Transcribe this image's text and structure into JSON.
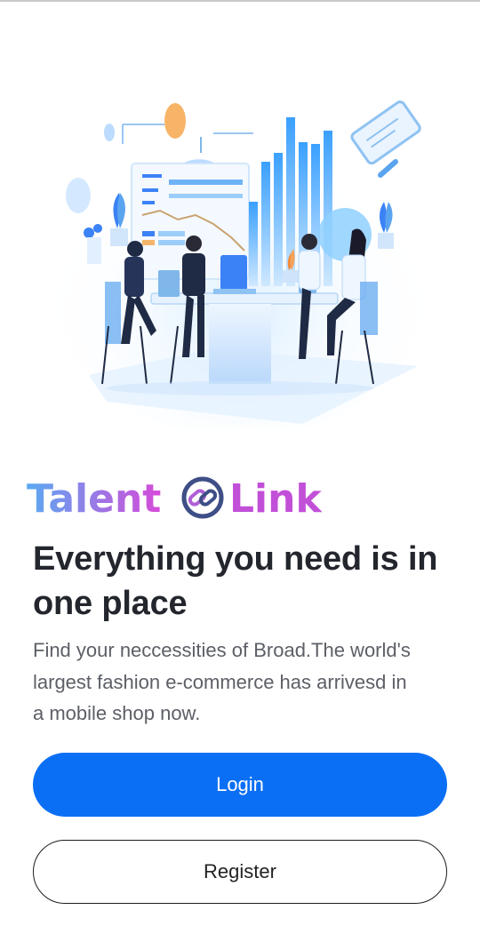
{
  "brand": {
    "part1": "Talent",
    "part2": "Link",
    "grad_start": "#5aaaf2",
    "grad_end": "#d64ad9"
  },
  "hero": {
    "headline_line1": "Everything you need is in",
    "headline_line2": "one place",
    "description_line1": "Find your neccessities of Broad.The world's",
    "description_line2": "largest fashion e-commerce has arrivesd in",
    "description_line3": "a mobile shop now."
  },
  "actions": {
    "login_label": "Login",
    "register_label": "Register",
    "accent": "#0b6ff5"
  },
  "illustration": {
    "icon": "office-team-meeting-illustration"
  }
}
